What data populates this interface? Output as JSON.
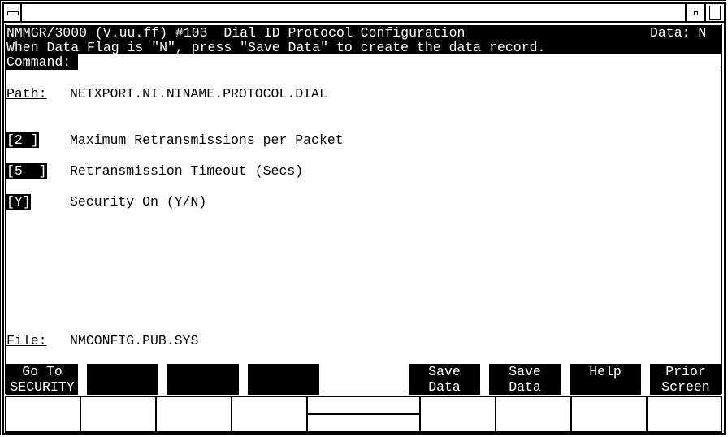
{
  "window": {
    "icons": [
      "window-menu-icon",
      "minimize-icon",
      "maximize-icon"
    ]
  },
  "header": {
    "title": "NMMGR/3000 (V.uu.ff) #103  Dial ID Protocol Configuration",
    "data_flag": "Data: N",
    "message": "When Data Flag is \"N\", press \"Save Data\" to create the data record.",
    "command_label": "Command:"
  },
  "path": {
    "label": "Path:",
    "value": "NETXPORT.NI.NINAME.PROTOCOL.DIAL"
  },
  "fields": [
    {
      "value": "[2 ]",
      "label": "Maximum Retransmissions per Packet"
    },
    {
      "value": "[5  ]",
      "label": "Retransmission Timeout (Secs)"
    },
    {
      "value": "[Y]",
      "label": "Security On (Y/N)"
    }
  ],
  "file": {
    "label": "File:",
    "value": "NMCONFIG.PUB.SYS"
  },
  "function_keys": [
    "Go To\nSECURITY",
    "",
    "",
    "",
    "",
    "Save\nData",
    "Help",
    "Prior\nScreen"
  ]
}
